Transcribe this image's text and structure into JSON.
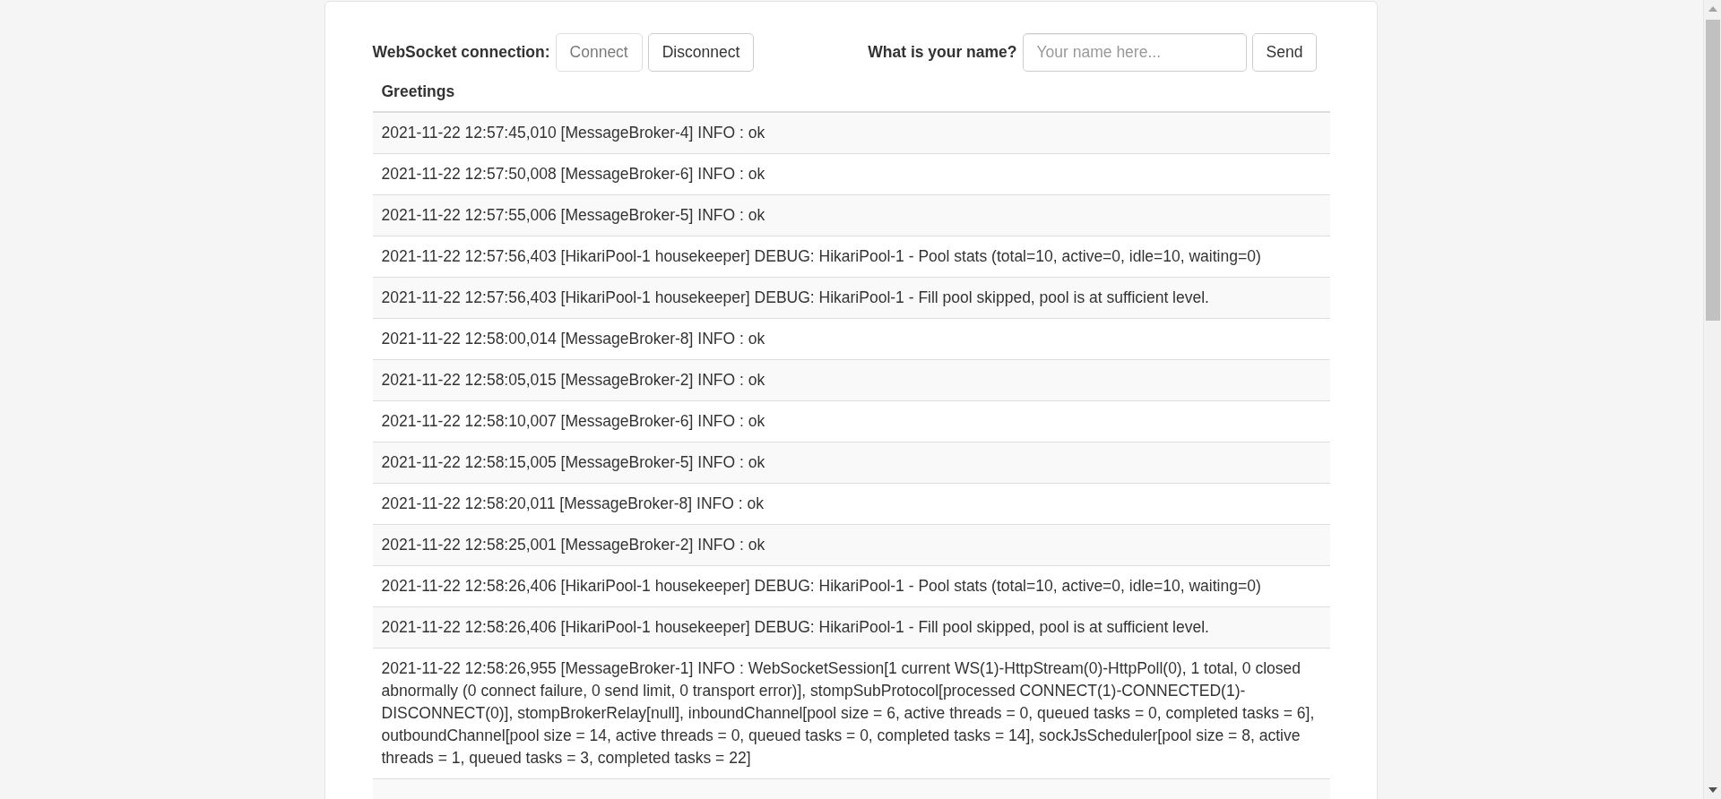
{
  "connection_form": {
    "label": "WebSocket connection:",
    "buttons": [
      {
        "label": "Connect",
        "disabled": true
      },
      {
        "label": "Disconnect",
        "disabled": false
      }
    ]
  },
  "name_form": {
    "label": "What is your name?",
    "input": {
      "placeholder": "Your name here..."
    },
    "button": {
      "label": "Send",
      "disabled": false
    }
  },
  "greetings_table": {
    "columns": [
      "Greetings"
    ],
    "rows": [
      "2021-11-22 12:57:45,010 [MessageBroker-4] INFO : ok",
      "2021-11-22 12:57:50,008 [MessageBroker-6] INFO : ok",
      "2021-11-22 12:57:55,006 [MessageBroker-5] INFO : ok",
      "2021-11-22 12:57:56,403 [HikariPool-1 housekeeper] DEBUG: HikariPool-1 - Pool stats (total=10, active=0, idle=10, waiting=0)",
      "2021-11-22 12:57:56,403 [HikariPool-1 housekeeper] DEBUG: HikariPool-1 - Fill pool skipped, pool is at sufficient level.",
      "2021-11-22 12:58:00,014 [MessageBroker-8] INFO : ok",
      "2021-11-22 12:58:05,015 [MessageBroker-2] INFO : ok",
      "2021-11-22 12:58:10,007 [MessageBroker-6] INFO : ok",
      "2021-11-22 12:58:15,005 [MessageBroker-5] INFO : ok",
      "2021-11-22 12:58:20,011 [MessageBroker-8] INFO : ok",
      "2021-11-22 12:58:25,001 [MessageBroker-2] INFO : ok",
      "2021-11-22 12:58:26,406 [HikariPool-1 housekeeper] DEBUG: HikariPool-1 - Pool stats (total=10, active=0, idle=10, waiting=0)",
      "2021-11-22 12:58:26,406 [HikariPool-1 housekeeper] DEBUG: HikariPool-1 - Fill pool skipped, pool is at sufficient level.",
      "2021-11-22 12:58:26,955 [MessageBroker-1] INFO : WebSocketSession[1 current WS(1)-HttpStream(0)-HttpPoll(0), 1 total, 0 closed abnormally (0 connect failure, 0 send limit, 0 transport error)], stompSubProtocol[processed CONNECT(1)-CONNECTED(1)-DISCONNECT(0)], stompBrokerRelay[null], inboundChannel[pool size = 6, active threads = 0, queued tasks = 0, completed tasks = 6], outboundChannel[pool size = 14, active threads = 0, queued tasks = 0, completed tasks = 14], sockJsScheduler[pool size = 8, active threads = 1, queued tasks = 3, completed tasks = 22]"
    ]
  }
}
